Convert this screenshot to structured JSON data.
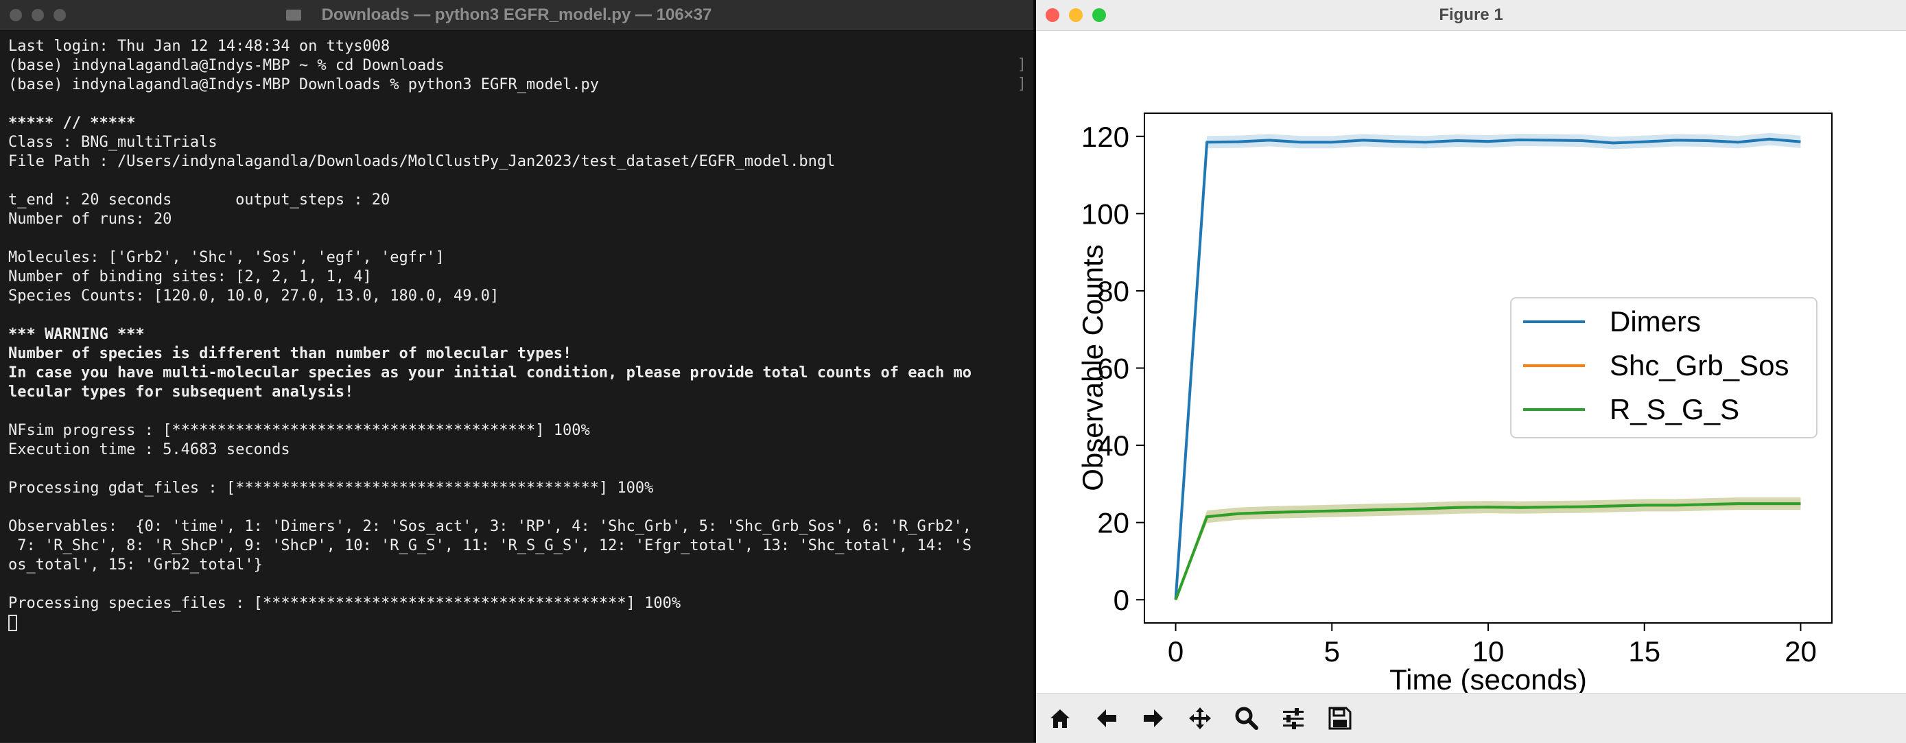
{
  "terminal": {
    "title": "Downloads — python3 EGFR_model.py — 106×37",
    "lines": [
      {
        "text": "Last login: Thu Jan 12 14:48:34 on ttys008",
        "bold": false
      },
      {
        "text": "(base) indynalagandla@Indys-MBP ~ % cd Downloads",
        "bold": false
      },
      {
        "text": "(base) indynalagandla@Indys-MBP Downloads % python3 EGFR_model.py",
        "bold": false
      },
      {
        "text": "",
        "bold": false
      },
      {
        "text": "***** // *****",
        "bold": true
      },
      {
        "text": "Class : BNG_multiTrials",
        "bold": false
      },
      {
        "text": "File Path : /Users/indynalagandla/Downloads/MolClustPy_Jan2023/test_dataset/EGFR_model.bngl",
        "bold": false
      },
      {
        "text": "",
        "bold": false
      },
      {
        "text": "t_end : 20 seconds       output_steps : 20",
        "bold": false
      },
      {
        "text": "Number of runs: 20",
        "bold": false
      },
      {
        "text": "",
        "bold": false
      },
      {
        "text": "Molecules: ['Grb2', 'Shc', 'Sos', 'egf', 'egfr']",
        "bold": false
      },
      {
        "text": "Number of binding sites: [2, 2, 1, 1, 4]",
        "bold": false
      },
      {
        "text": "Species Counts: [120.0, 10.0, 27.0, 13.0, 180.0, 49.0]",
        "bold": false
      },
      {
        "text": "",
        "bold": false
      },
      {
        "text": "*** WARNING ***",
        "bold": true
      },
      {
        "text": "Number of species is different than number of molecular types!",
        "bold": true
      },
      {
        "text": "In case you have multi-molecular species as your initial condition, please provide total counts of each mo",
        "bold": true
      },
      {
        "text": "lecular types for subsequent analysis!",
        "bold": true
      },
      {
        "text": "",
        "bold": false
      },
      {
        "text": "NFsim progress : [****************************************] 100%",
        "bold": false
      },
      {
        "text": "Execution time : 5.4683 seconds",
        "bold": false
      },
      {
        "text": "",
        "bold": false
      },
      {
        "text": "Processing gdat_files : [****************************************] 100%",
        "bold": false
      },
      {
        "text": "",
        "bold": false
      },
      {
        "text": "Observables:  {0: 'time', 1: 'Dimers', 2: 'Sos_act', 3: 'RP', 4: 'Shc_Grb', 5: 'Shc_Grb_Sos', 6: 'R_Grb2',",
        "bold": false
      },
      {
        "text": " 7: 'R_Shc', 8: 'R_ShcP', 9: 'ShcP', 10: 'R_G_S', 11: 'R_S_G_S', 12: 'Efgr_total', 13: 'Shc_total', 14: 'S",
        "bold": false
      },
      {
        "text": "os_total', 15: 'Grb2_total'}",
        "bold": false
      },
      {
        "text": "",
        "bold": false
      },
      {
        "text": "Processing species_files : [****************************************] 100%",
        "bold": false
      }
    ]
  },
  "figure": {
    "title": "Figure 1",
    "toolbar": [
      "home-icon",
      "back-arrow-icon",
      "forward-arrow-icon",
      "pan-icon",
      "zoom-icon",
      "configure-subplots-icon",
      "save-icon"
    ]
  },
  "chart_data": {
    "type": "line",
    "title": "",
    "xlabel": "Time (seconds)",
    "ylabel": "Observable Counts",
    "xlim": [
      -1,
      21.0
    ],
    "ylim": [
      -6,
      126
    ],
    "xticks": [
      0,
      5,
      10,
      15,
      20
    ],
    "yticks": [
      0,
      20,
      40,
      60,
      80,
      100,
      120
    ],
    "grid": false,
    "legend_position": "center-right",
    "x": [
      0,
      1,
      2,
      3,
      4,
      5,
      6,
      7,
      8,
      9,
      10,
      11,
      12,
      13,
      14,
      15,
      16,
      17,
      18,
      19,
      20
    ],
    "series": [
      {
        "name": "Dimers",
        "color": "#1f77b4",
        "values": [
          0,
          118.5,
          118.6,
          119.0,
          118.5,
          118.5,
          119.0,
          118.7,
          118.5,
          118.9,
          118.7,
          119.1,
          119.0,
          118.9,
          118.3,
          118.6,
          119.0,
          118.9,
          118.5,
          119.3,
          118.6
        ]
      },
      {
        "name": "Shc_Grb_Sos",
        "color": "#ff7f0e",
        "values": [
          0,
          21.5,
          22.3,
          22.6,
          22.8,
          23.0,
          23.2,
          23.4,
          23.6,
          23.9,
          24.0,
          23.9,
          24.0,
          24.1,
          24.3,
          24.5,
          24.5,
          24.7,
          24.9,
          24.9,
          24.9
        ]
      },
      {
        "name": "R_S_G_S",
        "color": "#2ca02c",
        "values": [
          0,
          21.5,
          22.3,
          22.6,
          22.8,
          23.0,
          23.2,
          23.4,
          23.6,
          23.9,
          24.0,
          23.9,
          24.0,
          24.1,
          24.3,
          24.5,
          24.5,
          24.7,
          24.9,
          24.9,
          24.9
        ]
      }
    ]
  }
}
